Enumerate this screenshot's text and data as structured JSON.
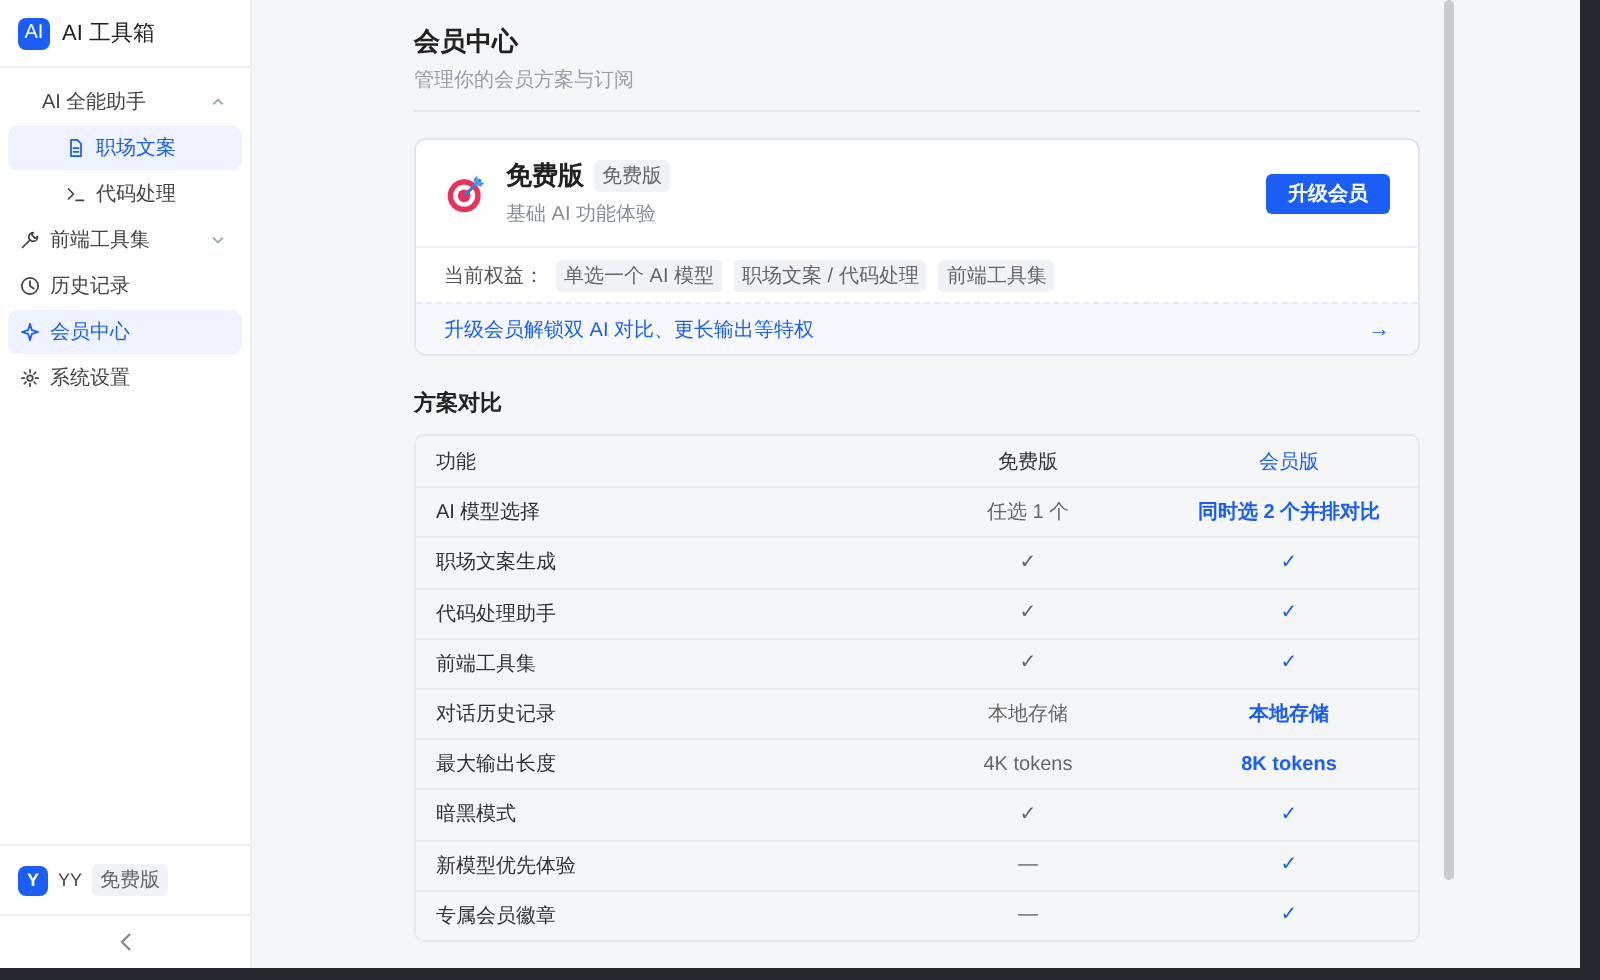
{
  "sidebar": {
    "logo": "AI",
    "title": "AI 工具箱",
    "items": [
      {
        "label": "AI 全能助手",
        "kind": "group",
        "expanded": true,
        "selected": false,
        "children": [
          {
            "label": "职场文案",
            "selected": true
          },
          {
            "label": "代码处理",
            "selected": false
          }
        ]
      },
      {
        "label": "前端工具集",
        "kind": "group",
        "expanded": false,
        "selected": false
      },
      {
        "label": "历史记录",
        "kind": "item",
        "selected": false
      },
      {
        "label": "会员中心",
        "kind": "item",
        "selected": true
      },
      {
        "label": "系统设置",
        "kind": "item",
        "selected": false
      }
    ],
    "user": {
      "avatar": "Y",
      "name": "YY",
      "badge": "免费版"
    }
  },
  "page": {
    "title": "会员中心",
    "subtitle": "管理你的会员方案与订阅"
  },
  "plan_card": {
    "name": "免费版",
    "badge": "免费版",
    "description": "基础 AI 功能体验",
    "button": "升级会员",
    "benefits_label": "当前权益：",
    "benefits": [
      "单选一个 AI 模型",
      "职场文案 / 代码处理",
      "前端工具集"
    ],
    "upgrade_link": "升级会员解锁双 AI 对比、更长输出等特权",
    "upgrade_arrow": "→"
  },
  "comparison": {
    "title": "方案对比",
    "columns": [
      "功能",
      "免费版",
      "会员版"
    ],
    "rows": [
      [
        "AI 模型选择",
        "任选 1 个",
        "同时选 2 个并排对比"
      ],
      [
        "职场文案生成",
        "✓",
        "✓"
      ],
      [
        "代码处理助手",
        "✓",
        "✓"
      ],
      [
        "前端工具集",
        "✓",
        "✓"
      ],
      [
        "对话历史记录",
        "本地存储",
        "本地存储"
      ],
      [
        "最大输出长度",
        "4K tokens",
        "8K tokens"
      ],
      [
        "暗黑模式",
        "✓",
        "✓"
      ],
      [
        "新模型优先体验",
        "—",
        "✓"
      ],
      [
        "专属会员徽章",
        "—",
        "✓"
      ]
    ]
  }
}
